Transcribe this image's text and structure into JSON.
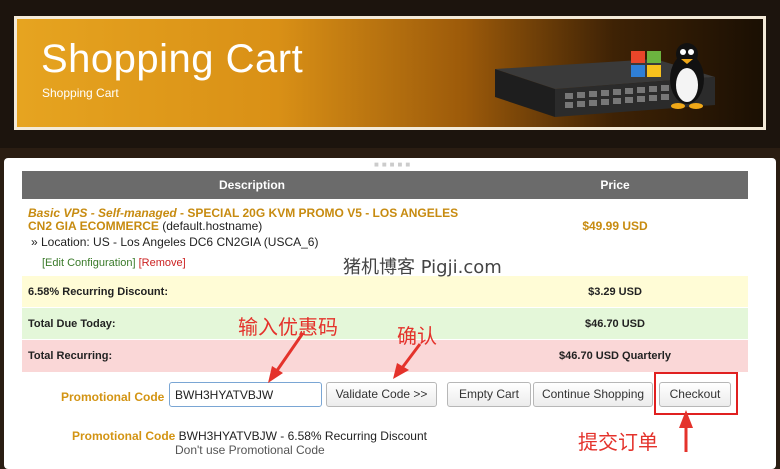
{
  "banner": {
    "title": "Shopping Cart",
    "subtitle": "Shopping Cart"
  },
  "table": {
    "headers": {
      "description": "Description",
      "price": "Price"
    },
    "item": {
      "name_italic": "Basic VPS - Self-managed",
      "name_rest": " - SPECIAL 20G KVM PROMO V5 - LOS ANGELES CN2 GIA ECOMMERCE",
      "hostname": " (default.hostname)",
      "location": "» Location: US - Los Angeles DC6 CN2GIA (USCA_6)",
      "price": "$49.99 USD",
      "edit_link": "[Edit Configuration]",
      "remove_link": "[Remove]"
    },
    "summary": [
      {
        "label": "6.58% Recurring Discount:",
        "value": "$3.29 USD"
      },
      {
        "label": "Total Due Today:",
        "value": "$46.70 USD"
      },
      {
        "label": "Total Recurring:",
        "value": "$46.70 USD Quarterly"
      }
    ]
  },
  "promo": {
    "label": "Promotional Code",
    "input_value": "BWH3HYATVBJW",
    "validate_button": "Validate Code >>",
    "empty_cart_button": "Empty Cart",
    "continue_button": "Continue Shopping",
    "checkout_button": "Checkout",
    "applied_label": "Promotional Code",
    "applied_text": " BWH3HYATVBJW - 6.58% Recurring Discount",
    "remove_text": "Don't use Promotional Code"
  },
  "annotations": {
    "watermark": "猪机博客 Pigji.com",
    "enter_promo": "输入优惠码",
    "confirm": "确认",
    "submit_order": "提交订单"
  },
  "colors": {
    "accent": "#d39413",
    "annotation": "#e4322b"
  }
}
